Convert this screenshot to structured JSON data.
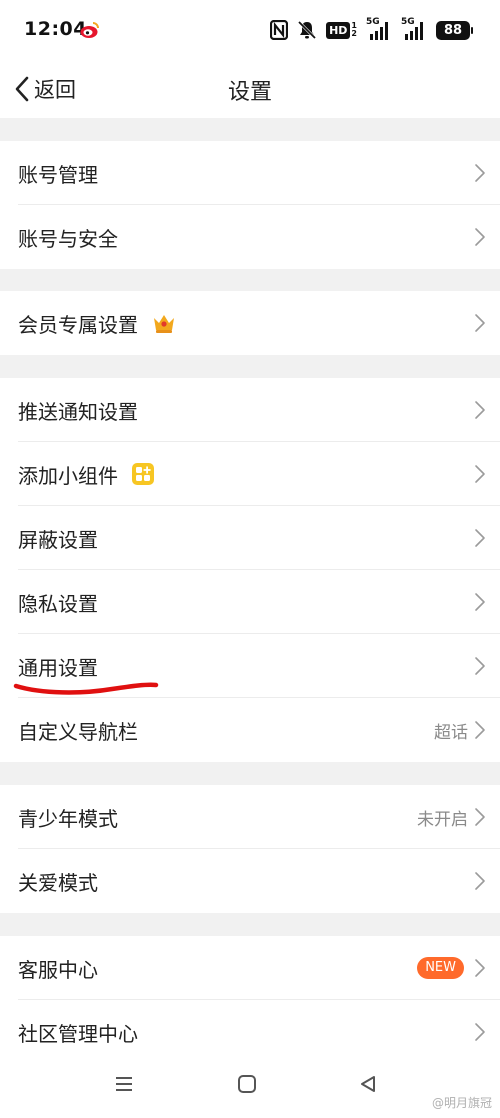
{
  "status_bar": {
    "time": "12:04",
    "battery": "88",
    "hd_label": "HD",
    "hd_sim": "1",
    "hd_sim2": "2",
    "network_1": "5G",
    "network_2": "5G"
  },
  "header": {
    "back_label": "返回",
    "title": "设置"
  },
  "groups": [
    {
      "items": [
        {
          "label": "账号管理"
        },
        {
          "label": "账号与安全"
        }
      ]
    },
    {
      "items": [
        {
          "label": "会员专属设置",
          "icon": "crown-icon"
        }
      ]
    },
    {
      "items": [
        {
          "label": "推送通知设置"
        },
        {
          "label": "添加小组件",
          "icon": "widget-grid-icon"
        },
        {
          "label": "屏蔽设置"
        },
        {
          "label": "隐私设置"
        },
        {
          "label": "通用设置",
          "annotated": true
        },
        {
          "label": "自定义导航栏",
          "value": "超话"
        }
      ]
    },
    {
      "items": [
        {
          "label": "青少年模式",
          "value": "未开启"
        },
        {
          "label": "关爱模式"
        }
      ]
    },
    {
      "items": [
        {
          "label": "客服中心",
          "badge": "NEW"
        },
        {
          "label": "社区管理中心"
        }
      ]
    }
  ],
  "colors": {
    "badge": "#ff6a2b",
    "annotation_stroke": "#e01010",
    "crown": "#f2a81d",
    "widget_icon": "#f7c623",
    "group_gap": "#f1f1f1"
  },
  "watermark": "@明月旗冠"
}
